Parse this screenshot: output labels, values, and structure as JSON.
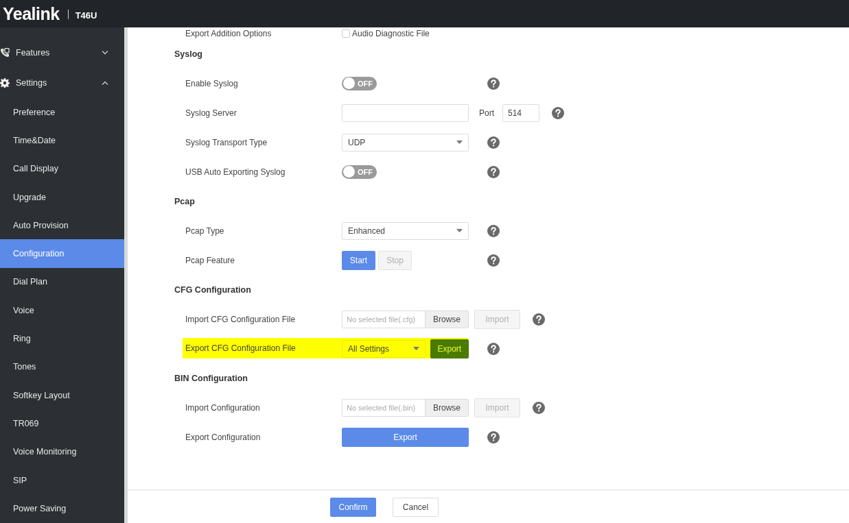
{
  "header": {
    "logo": "Yealink",
    "model": "T46U"
  },
  "sidebar": {
    "items": [
      {
        "label": "Features",
        "kind": "group",
        "expanded": false
      },
      {
        "label": "Settings",
        "kind": "group",
        "expanded": true
      },
      {
        "label": "Preference",
        "kind": "sub",
        "selected": false
      },
      {
        "label": "Time&Date",
        "kind": "sub",
        "selected": false
      },
      {
        "label": "Call Display",
        "kind": "sub",
        "selected": false
      },
      {
        "label": "Upgrade",
        "kind": "sub",
        "selected": false
      },
      {
        "label": "Auto Provision",
        "kind": "sub",
        "selected": false
      },
      {
        "label": "Configuration",
        "kind": "sub",
        "selected": true
      },
      {
        "label": "Dial Plan",
        "kind": "sub",
        "selected": false
      },
      {
        "label": "Voice",
        "kind": "sub",
        "selected": false
      },
      {
        "label": "Ring",
        "kind": "sub",
        "selected": false
      },
      {
        "label": "Tones",
        "kind": "sub",
        "selected": false
      },
      {
        "label": "Softkey Layout",
        "kind": "sub",
        "selected": false
      },
      {
        "label": "TR069",
        "kind": "sub",
        "selected": false
      },
      {
        "label": "Voice Monitoring",
        "kind": "sub",
        "selected": false
      },
      {
        "label": "SIP",
        "kind": "sub",
        "selected": false
      },
      {
        "label": "Power Saving",
        "kind": "sub",
        "selected": false
      }
    ]
  },
  "sections": [
    {
      "rows": [
        {
          "label": "Export Addition Options",
          "kind": "checkbox",
          "option": "Audio Diagnostic File",
          "checked": false,
          "highlighted": false
        }
      ]
    },
    {
      "title": "Syslog",
      "rows": [
        {
          "label": "Enable Syslog",
          "kind": "toggle",
          "on": false,
          "state_text": "OFF",
          "highlighted": false
        },
        {
          "label": "Syslog Server",
          "kind": "text_port",
          "value": "",
          "port_label": "Port",
          "port": "514",
          "highlighted": false
        },
        {
          "label": "Syslog Transport Type",
          "kind": "select",
          "value": "UDP",
          "highlighted": false
        },
        {
          "label": "USB Auto Exporting Syslog",
          "kind": "toggle",
          "on": false,
          "state_text": "OFF",
          "highlighted": false
        }
      ]
    },
    {
      "title": "Pcap",
      "rows": [
        {
          "label": "Pcap Type",
          "kind": "select",
          "value": "Enhanced",
          "highlighted": false
        },
        {
          "label": "Pcap Feature",
          "kind": "buttons",
          "buttons": [
            {
              "label": "Start",
              "disabled": false
            },
            {
              "label": "Stop",
              "disabled": true
            }
          ],
          "highlighted": false
        }
      ]
    },
    {
      "title": "CFG Configuration",
      "rows": [
        {
          "label": "Import CFG Configuration File",
          "kind": "file",
          "placeholder": "No selected file(.cfg)",
          "browse": "Browse",
          "action": "Import",
          "highlighted": false
        },
        {
          "label": "Export CFG Configuration File",
          "kind": "select_button",
          "value": "All Settings",
          "action": "Export",
          "highlighted": true
        }
      ]
    },
    {
      "title": "BIN Configuration",
      "rows": [
        {
          "label": "Import Configuration",
          "kind": "file",
          "placeholder": "No selected file(.bin)",
          "browse": "Browse",
          "action": "Import",
          "highlighted": false
        },
        {
          "label": "Export Configuration",
          "kind": "wide_button",
          "action": "Export",
          "highlighted": false
        }
      ]
    }
  ],
  "footer": {
    "buttons": [
      {
        "label": "Confirm",
        "primary": true
      },
      {
        "label": "Cancel",
        "primary": false
      }
    ]
  }
}
